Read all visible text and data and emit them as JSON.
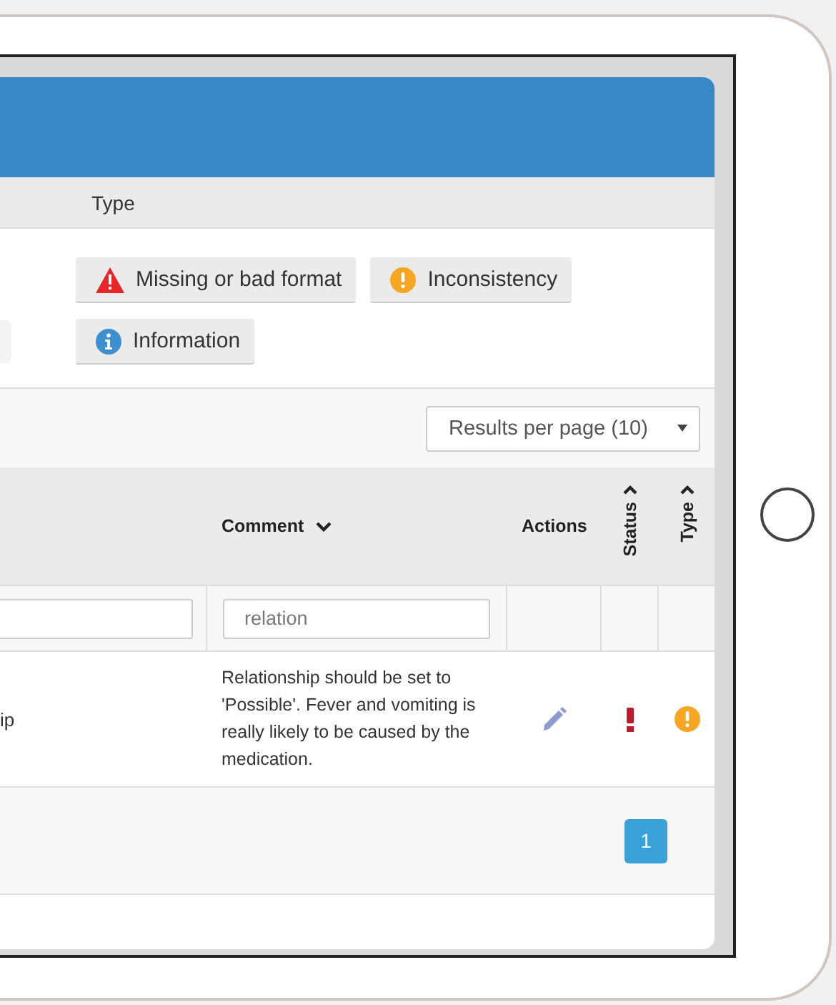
{
  "filter_panel": {
    "heading": "Type",
    "buttons": [
      {
        "label": "Missing or bad format",
        "kind": "warning"
      },
      {
        "label": "Inconsistency",
        "kind": "inconsistency"
      },
      {
        "label": "Information",
        "kind": "info"
      }
    ]
  },
  "results_per_page": "Results per page (10)",
  "table": {
    "columns": [
      {
        "label": "Comment",
        "kind": "descending"
      },
      {
        "label": "Actions",
        "kind": "plain"
      },
      {
        "label": "Status",
        "kind": "ascending-vertical"
      },
      {
        "label": "Type",
        "kind": "ascending-vertical"
      }
    ],
    "comment_filter": "relation",
    "rows": [
      {
        "column_1": "ip",
        "comment": "Relationship should be set to 'Possible'. Fever and vomiting is really likely to be caused by the medication.",
        "status": {
          "kind": "error"
        },
        "type": {
          "kind": "inconsistency"
        }
      }
    ]
  },
  "pagination": [
    {
      "label": "1",
      "selected": true
    }
  ]
}
